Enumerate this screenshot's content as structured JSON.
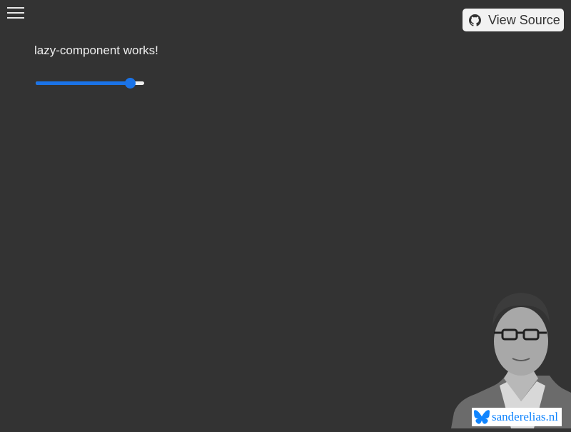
{
  "header": {
    "menu_icon": "hamburger-menu-icon",
    "view_source": {
      "icon": "github-icon",
      "label": "View Source"
    }
  },
  "main": {
    "text": "lazy-component works!",
    "slider": {
      "value_fraction": 0.87
    }
  },
  "footer_badge": {
    "portrait": "author-portrait",
    "icon": "bluesky-butterfly-icon",
    "label": "sanderelias.nl"
  },
  "colors": {
    "background": "#333333",
    "accent": "#1a73e8",
    "text": "#eeeeee",
    "button_bg": "#f2f2f2",
    "brand": "#1185fe"
  }
}
